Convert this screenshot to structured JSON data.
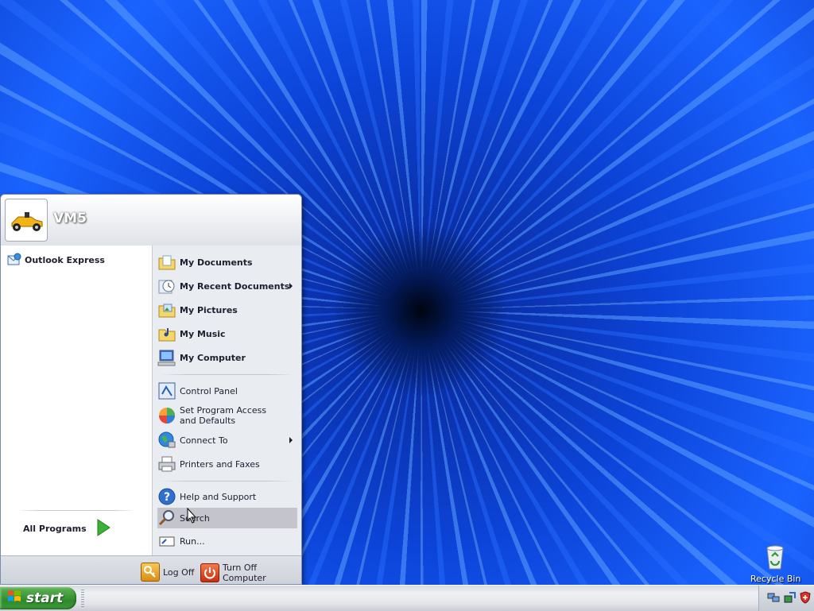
{
  "desktop": {
    "recycle_bin_label": "Recycle Bin"
  },
  "start_menu": {
    "user_name": "VM5",
    "pinned": [
      {
        "label": "Outlook Express",
        "icon": "outlook-express-icon"
      }
    ],
    "all_programs_label": "All Programs",
    "places": [
      {
        "label": "My Documents",
        "icon": "documents-folder-icon"
      },
      {
        "label": "My Recent Documents",
        "icon": "recent-documents-icon",
        "submenu": true
      },
      {
        "label": "My Pictures",
        "icon": "pictures-folder-icon"
      },
      {
        "label": "My Music",
        "icon": "music-folder-icon"
      },
      {
        "label": "My Computer",
        "icon": "computer-icon"
      }
    ],
    "settings": [
      {
        "label": "Control Panel",
        "icon": "control-panel-icon"
      },
      {
        "label": "Set Program Access and Defaults",
        "icon": "program-access-icon"
      },
      {
        "label": "Connect To",
        "icon": "connect-globe-icon",
        "submenu": true
      },
      {
        "label": "Printers and Faxes",
        "icon": "printer-icon"
      }
    ],
    "tools": [
      {
        "label": "Help and Support",
        "icon": "help-icon"
      },
      {
        "label": "Search",
        "icon": "search-icon",
        "highlighted": true
      },
      {
        "label": "Run...",
        "icon": "run-icon"
      }
    ],
    "log_off_label": "Log Off",
    "turn_off_label": "Turn Off Computer"
  },
  "taskbar": {
    "start_label": "start"
  },
  "colors": {
    "start_green": "#3f9a3a",
    "menu_right_pane": "#e9ecf1",
    "highlight": "#c3c4cc",
    "desktop_blue": "#0c44d8"
  }
}
